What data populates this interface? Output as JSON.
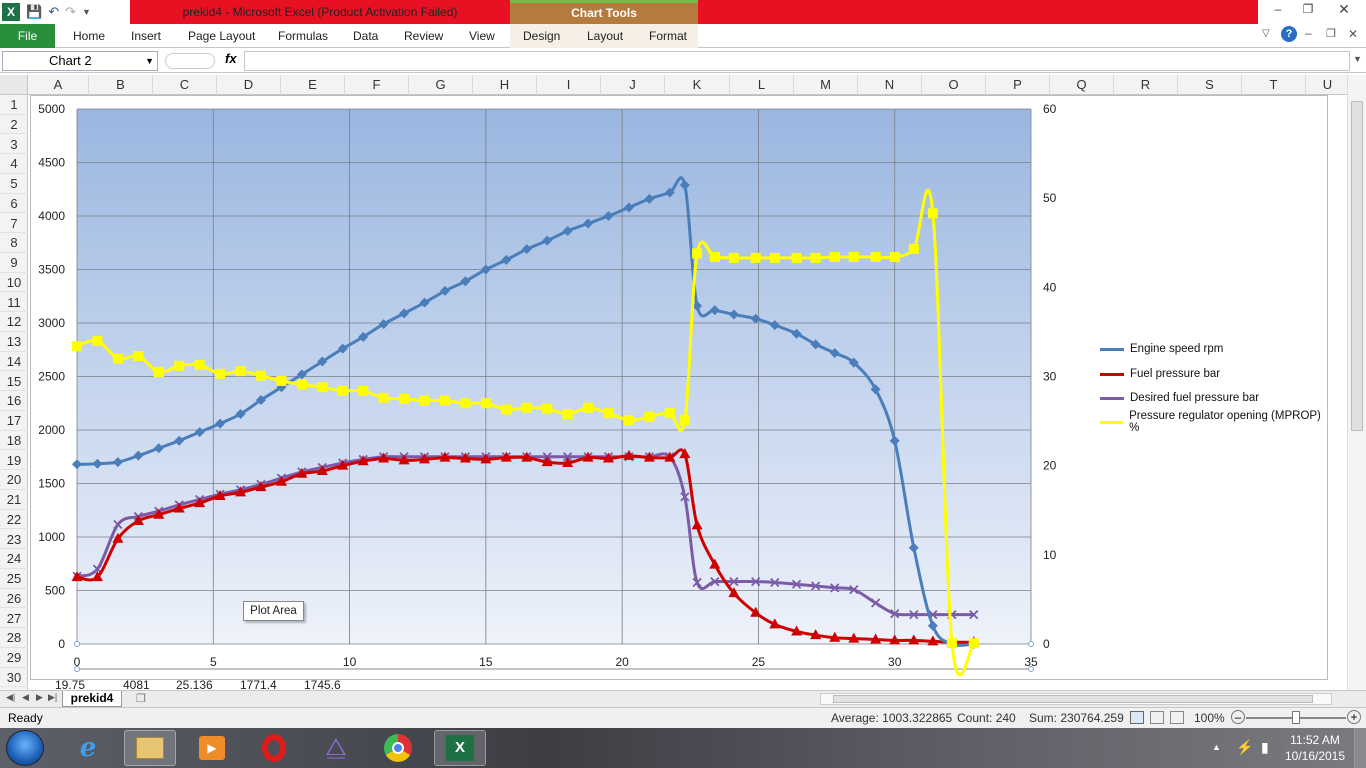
{
  "window": {
    "title": "prekid4  -  Microsoft Excel (Product Activation Failed)",
    "contextual_tab_group": "Chart Tools",
    "colors": {
      "alert_bar": "#e81123",
      "file_tab": "#2a8f3b",
      "chart_tools": "#b57a3e"
    }
  },
  "ribbon": {
    "file": "File",
    "tabs": [
      "Home",
      "Insert",
      "Page Layout",
      "Formulas",
      "Data",
      "Review",
      "View"
    ],
    "chart_tabs": [
      "Design",
      "Layout",
      "Format"
    ]
  },
  "formula_bar": {
    "name_box": "Chart 2",
    "fx": "fx",
    "formula": ""
  },
  "grid": {
    "columns": [
      "A",
      "B",
      "C",
      "D",
      "E",
      "F",
      "G",
      "H",
      "I",
      "J",
      "K",
      "L",
      "M",
      "N",
      "O",
      "P",
      "Q",
      "R",
      "S",
      "T",
      "U"
    ],
    "rows": [
      "1",
      "2",
      "3",
      "4",
      "5",
      "6",
      "7",
      "8",
      "9",
      "10",
      "11",
      "12",
      "13",
      "14",
      "15",
      "16",
      "17",
      "18",
      "19",
      "20",
      "21",
      "22",
      "23",
      "24",
      "25",
      "26",
      "27",
      "28",
      "29",
      "30"
    ],
    "row30_values": [
      "19.75",
      "4081",
      "25.136",
      "1771.4",
      "1745.6"
    ]
  },
  "sheet": {
    "tab": "prekid4"
  },
  "status": {
    "ready": "Ready",
    "average": "Average: 1003.322865",
    "count": "Count: 240",
    "sum": "Sum: 230764.259",
    "zoom": "100%"
  },
  "taskbar": {
    "time": "11:52 AM",
    "date": "10/16/2015",
    "apps": [
      "start-orb",
      "internet-explorer-icon",
      "file-explorer-icon",
      "media-player-icon",
      "opera-icon",
      "visual-studio-icon",
      "chrome-icon",
      "excel-icon"
    ]
  },
  "chart_data": {
    "type": "scatter",
    "title": "",
    "plot_area_tooltip": "Plot Area",
    "x_axis": {
      "min": 0,
      "max": 35,
      "ticks": [
        0,
        5,
        10,
        15,
        20,
        25,
        30,
        35
      ]
    },
    "y_axis_left": {
      "min": 0,
      "max": 5000,
      "ticks": [
        0,
        500,
        1000,
        1500,
        2000,
        2500,
        3000,
        3500,
        4000,
        4500,
        5000
      ]
    },
    "y_axis_right": {
      "min": 0,
      "max": 60,
      "ticks": [
        0,
        10,
        20,
        30,
        40,
        50,
        60
      ]
    },
    "grid": true,
    "legend_position": "right",
    "series": [
      {
        "name": "Engine speed rpm",
        "axis": "left",
        "color": "#4a7ebb",
        "marker": "diamond",
        "points": [
          [
            0,
            1680
          ],
          [
            0.75,
            1685
          ],
          [
            1.5,
            1700
          ],
          [
            2.25,
            1760
          ],
          [
            3,
            1830
          ],
          [
            3.75,
            1900
          ],
          [
            4.5,
            1980
          ],
          [
            5.25,
            2060
          ],
          [
            6,
            2150
          ],
          [
            6.75,
            2280
          ],
          [
            7.5,
            2400
          ],
          [
            8.25,
            2520
          ],
          [
            9,
            2640
          ],
          [
            9.75,
            2760
          ],
          [
            10.5,
            2870
          ],
          [
            11.25,
            2990
          ],
          [
            12,
            3090
          ],
          [
            12.75,
            3190
          ],
          [
            13.5,
            3300
          ],
          [
            14.25,
            3390
          ],
          [
            15,
            3500
          ],
          [
            15.75,
            3590
          ],
          [
            16.5,
            3690
          ],
          [
            17.25,
            3770
          ],
          [
            18,
            3860
          ],
          [
            18.75,
            3930
          ],
          [
            19.5,
            4000
          ],
          [
            20.25,
            4080
          ],
          [
            21,
            4160
          ],
          [
            21.75,
            4220
          ],
          [
            22.3,
            4290
          ],
          [
            22.75,
            3160
          ],
          [
            23.4,
            3120
          ],
          [
            24.1,
            3080
          ],
          [
            24.9,
            3040
          ],
          [
            25.6,
            2980
          ],
          [
            26.4,
            2900
          ],
          [
            27.1,
            2800
          ],
          [
            27.8,
            2720
          ],
          [
            28.5,
            2630
          ],
          [
            29.3,
            2380
          ],
          [
            30,
            1900
          ],
          [
            30.7,
            900
          ],
          [
            31.4,
            170
          ],
          [
            32.1,
            0
          ],
          [
            32.9,
            0
          ]
        ]
      },
      {
        "name": "Fuel pressure bar",
        "axis": "right",
        "color": "#d00000",
        "marker": "triangle",
        "points": [
          [
            0,
            7.5
          ],
          [
            0.75,
            7.5
          ],
          [
            1.5,
            11.8
          ],
          [
            2.25,
            13.8
          ],
          [
            3,
            14.5
          ],
          [
            3.75,
            15.2
          ],
          [
            4.5,
            15.8
          ],
          [
            5.25,
            16.6
          ],
          [
            6,
            17.0
          ],
          [
            6.75,
            17.6
          ],
          [
            7.5,
            18.2
          ],
          [
            8.25,
            19.1
          ],
          [
            9,
            19.4
          ],
          [
            9.75,
            20.0
          ],
          [
            10.5,
            20.5
          ],
          [
            11.25,
            20.8
          ],
          [
            12,
            20.6
          ],
          [
            12.75,
            20.7
          ],
          [
            13.5,
            20.9
          ],
          [
            14.25,
            20.8
          ],
          [
            15,
            20.7
          ],
          [
            15.75,
            20.9
          ],
          [
            16.5,
            20.9
          ],
          [
            17.25,
            20.4
          ],
          [
            18,
            20.3
          ],
          [
            18.75,
            20.9
          ],
          [
            19.5,
            20.8
          ],
          [
            20.25,
            21.1
          ],
          [
            21,
            20.9
          ],
          [
            21.75,
            20.9
          ],
          [
            22.3,
            21.3
          ],
          [
            22.75,
            13.3
          ],
          [
            23.4,
            8.9
          ],
          [
            24.1,
            5.7
          ],
          [
            24.9,
            3.5
          ],
          [
            25.6,
            2.2
          ],
          [
            26.4,
            1.4
          ],
          [
            27.1,
            1.0
          ],
          [
            27.8,
            0.7
          ],
          [
            28.5,
            0.6
          ],
          [
            29.3,
            0.5
          ],
          [
            30,
            0.4
          ],
          [
            30.7,
            0.4
          ],
          [
            31.4,
            0.3
          ],
          [
            32.1,
            0.2
          ],
          [
            32.9,
            0.2
          ]
        ]
      },
      {
        "name": "Desired fuel pressure bar",
        "axis": "right",
        "color": "#7b5ba8",
        "marker": "x",
        "points": [
          [
            0,
            7.6
          ],
          [
            0.75,
            8.4
          ],
          [
            1.5,
            13.4
          ],
          [
            2.25,
            14.3
          ],
          [
            3,
            14.9
          ],
          [
            3.75,
            15.6
          ],
          [
            4.5,
            16.2
          ],
          [
            5.25,
            16.8
          ],
          [
            6,
            17.3
          ],
          [
            6.75,
            17.9
          ],
          [
            7.5,
            18.6
          ],
          [
            8.25,
            19.3
          ],
          [
            9,
            19.8
          ],
          [
            9.75,
            20.3
          ],
          [
            10.5,
            20.7
          ],
          [
            11.25,
            21.0
          ],
          [
            12,
            21.0
          ],
          [
            12.75,
            21.0
          ],
          [
            13.5,
            21.0
          ],
          [
            14.25,
            21.0
          ],
          [
            15,
            21.0
          ],
          [
            15.75,
            21.0
          ],
          [
            16.5,
            21.0
          ],
          [
            17.25,
            21.0
          ],
          [
            18,
            21.0
          ],
          [
            18.75,
            21.0
          ],
          [
            19.5,
            21.0
          ],
          [
            20.25,
            21.0
          ],
          [
            21,
            21.0
          ],
          [
            21.75,
            21.0
          ],
          [
            22.3,
            16.5
          ],
          [
            22.75,
            6.9
          ],
          [
            23.4,
            7.0
          ],
          [
            24.1,
            7.0
          ],
          [
            24.9,
            7.0
          ],
          [
            25.6,
            6.9
          ],
          [
            26.4,
            6.7
          ],
          [
            27.1,
            6.5
          ],
          [
            27.8,
            6.3
          ],
          [
            28.5,
            6.1
          ],
          [
            29.3,
            4.6
          ],
          [
            30,
            3.4
          ],
          [
            30.7,
            3.3
          ],
          [
            31.4,
            3.3
          ],
          [
            32.1,
            3.3
          ],
          [
            32.9,
            3.3
          ]
        ]
      },
      {
        "name": "Pressure regulator opening (MPROP) %",
        "axis": "right",
        "color": "#ffff00",
        "marker": "square",
        "points": [
          [
            0,
            33.4
          ],
          [
            0.75,
            34.0
          ],
          [
            1.5,
            32.0
          ],
          [
            2.25,
            32.3
          ],
          [
            3,
            30.5
          ],
          [
            3.75,
            31.2
          ],
          [
            4.5,
            31.3
          ],
          [
            5.25,
            30.3
          ],
          [
            6,
            30.6
          ],
          [
            6.75,
            30.1
          ],
          [
            7.5,
            29.5
          ],
          [
            8.25,
            29.1
          ],
          [
            9,
            28.8
          ],
          [
            9.75,
            28.4
          ],
          [
            10.5,
            28.4
          ],
          [
            11.25,
            27.6
          ],
          [
            12,
            27.5
          ],
          [
            12.75,
            27.3
          ],
          [
            13.5,
            27.3
          ],
          [
            14.25,
            27.0
          ],
          [
            15,
            27.0
          ],
          [
            15.75,
            26.3
          ],
          [
            16.5,
            26.5
          ],
          [
            17.25,
            26.4
          ],
          [
            18,
            25.8
          ],
          [
            18.75,
            26.5
          ],
          [
            19.5,
            25.9
          ],
          [
            20.25,
            25.1
          ],
          [
            21,
            25.5
          ],
          [
            21.75,
            25.9
          ],
          [
            22.3,
            25.1
          ],
          [
            22.75,
            43.8
          ],
          [
            23.4,
            43.4
          ],
          [
            24.1,
            43.3
          ],
          [
            24.9,
            43.3
          ],
          [
            25.6,
            43.3
          ],
          [
            26.4,
            43.3
          ],
          [
            27.1,
            43.3
          ],
          [
            27.8,
            43.4
          ],
          [
            28.5,
            43.4
          ],
          [
            29.3,
            43.4
          ],
          [
            30,
            43.4
          ],
          [
            30.7,
            44.3
          ],
          [
            31.4,
            48.3
          ],
          [
            32.1,
            0.1
          ],
          [
            32.9,
            0.1
          ]
        ]
      }
    ]
  }
}
